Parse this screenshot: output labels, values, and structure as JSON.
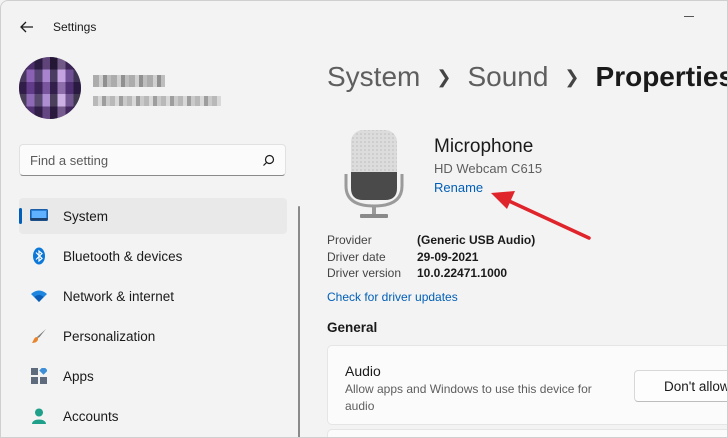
{
  "window": {
    "app_title": "Settings"
  },
  "search": {
    "placeholder": "Find a setting"
  },
  "sidebar": {
    "items": [
      {
        "label": "System",
        "icon": "system-display-icon",
        "active": true
      },
      {
        "label": "Bluetooth & devices",
        "icon": "bluetooth-icon",
        "active": false
      },
      {
        "label": "Network & internet",
        "icon": "wifi-icon",
        "active": false
      },
      {
        "label": "Personalization",
        "icon": "paintbrush-icon",
        "active": false
      },
      {
        "label": "Apps",
        "icon": "apps-icon",
        "active": false
      },
      {
        "label": "Accounts",
        "icon": "person-icon",
        "active": false
      }
    ]
  },
  "breadcrumb": {
    "items": [
      "System",
      "Sound",
      "Properties"
    ]
  },
  "device": {
    "name": "Microphone",
    "model": "HD Webcam C615",
    "rename_label": "Rename"
  },
  "details": {
    "rows": [
      {
        "key": "Provider",
        "value": "(Generic USB Audio)"
      },
      {
        "key": "Driver date",
        "value": "29-09-2021"
      },
      {
        "key": "Driver version",
        "value": "10.0.22471.1000"
      }
    ],
    "check_updates_label": "Check for driver updates"
  },
  "general": {
    "title": "General",
    "audio": {
      "title": "Audio",
      "description": "Allow apps and Windows to use this device for audio",
      "button_label": "Don't allow"
    }
  },
  "colors": {
    "accent": "#005fb8",
    "annotation_arrow": "#e0242b"
  }
}
